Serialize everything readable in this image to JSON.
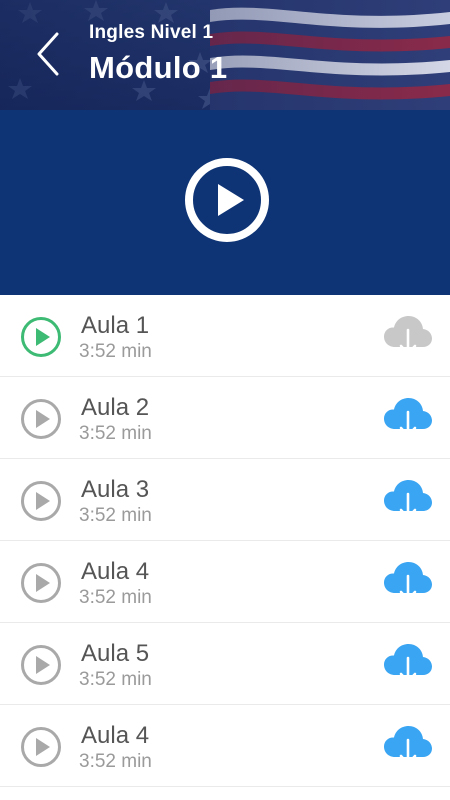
{
  "header": {
    "subtitle": "Ingles Nivel 1",
    "title": "Módulo 1",
    "back_icon": "chevron-left-icon"
  },
  "player": {
    "play_icon": "play-circle-icon",
    "background": "#0e3475"
  },
  "colors": {
    "active": "#3dba73",
    "inactive": "#a9a9a9",
    "download_active": "#3aa5f2",
    "download_inactive": "#c8c8c8"
  },
  "lessons": [
    {
      "title": "Aula 1",
      "duration": "3:52 min",
      "state": "active",
      "download": "cloud-download-icon-disabled"
    },
    {
      "title": "Aula 2",
      "duration": "3:52 min",
      "state": "inactive",
      "download": "cloud-download-icon"
    },
    {
      "title": "Aula 3",
      "duration": "3:52 min",
      "state": "inactive",
      "download": "cloud-download-icon"
    },
    {
      "title": "Aula 4",
      "duration": "3:52 min",
      "state": "inactive",
      "download": "cloud-download-icon"
    },
    {
      "title": "Aula 5",
      "duration": "3:52 min",
      "state": "inactive",
      "download": "cloud-download-icon"
    },
    {
      "title": "Aula 4",
      "duration": "3:52 min",
      "state": "inactive",
      "download": "cloud-download-icon"
    }
  ]
}
